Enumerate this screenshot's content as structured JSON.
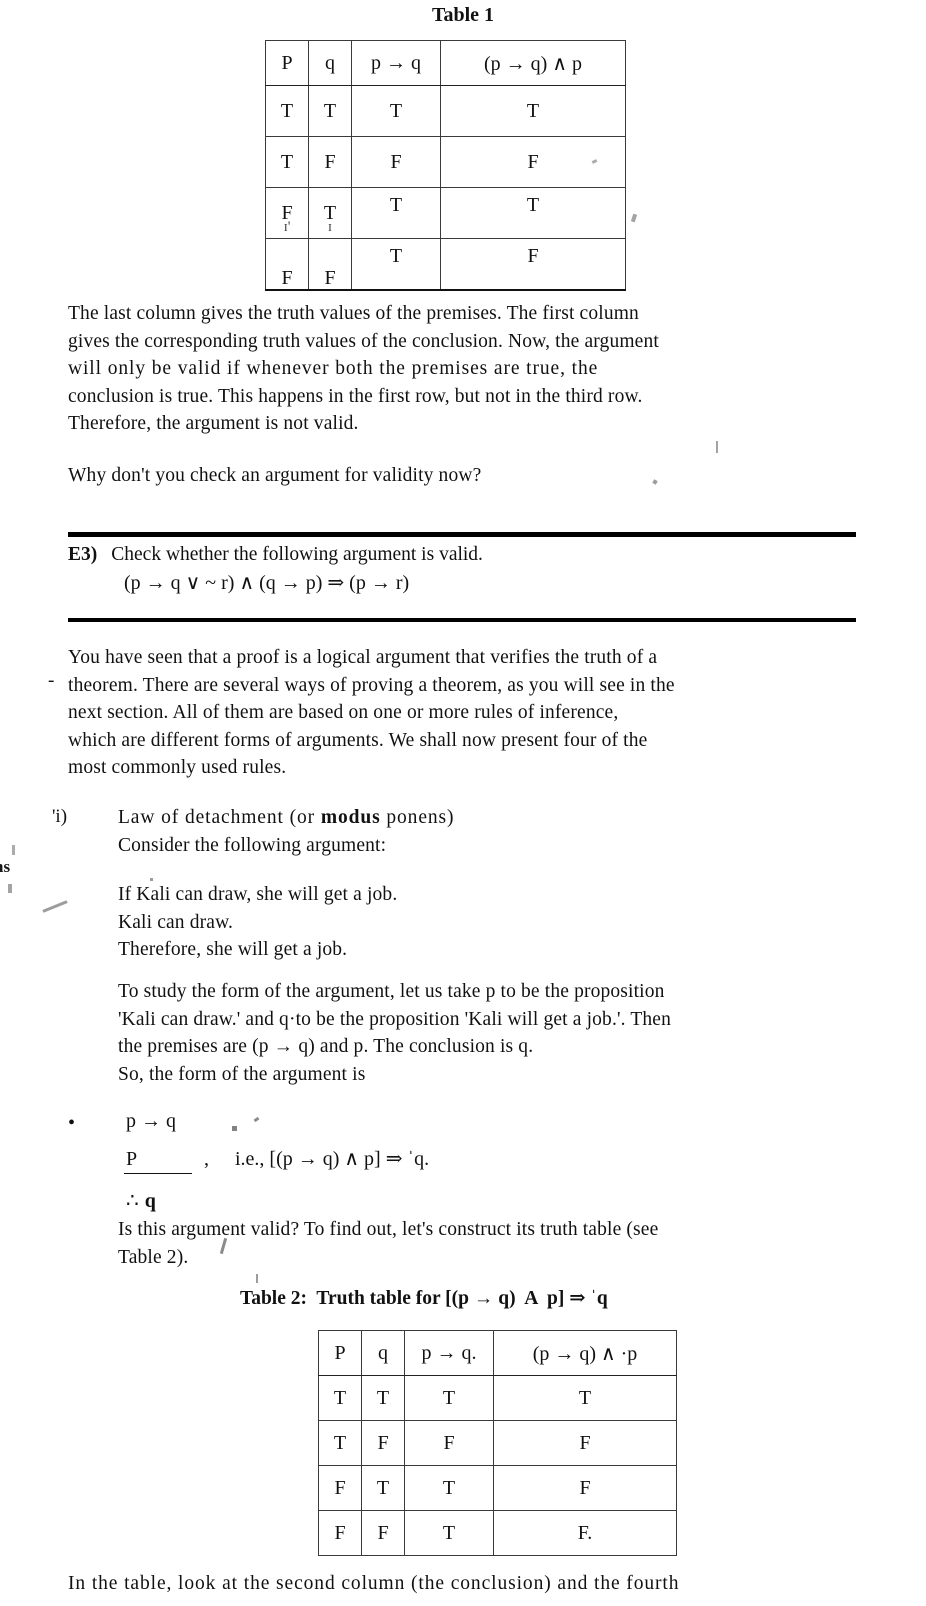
{
  "document": {
    "kind": "scanned-textbook-page",
    "topic": "Logical arguments, validity and rules of inference"
  },
  "table1": {
    "caption": "Table 1",
    "headers": [
      "P",
      "q",
      "p → q",
      "(p → q)  ∧  p"
    ],
    "rows": [
      [
        "T",
        "T",
        "T",
        "T"
      ],
      [
        "T",
        "F",
        "F",
        "F"
      ],
      [
        "F",
        "T",
        "T",
        "T"
      ],
      [
        "F",
        "F",
        "T",
        "F"
      ]
    ]
  },
  "paragraph1": {
    "lines": [
      "The last column gives the truth values of the premises. The first column",
      "gives the corresponding truth values of the conclusion. Now, the argument",
      "will only be valid if whenever both the premises are true, the",
      "conclusion is true. This happens in the first row, but not in the third row.",
      "Therefore, the argument is not valid."
    ]
  },
  "paragraph2": {
    "text": "Why don't you check an argument for validity now?"
  },
  "exercise": {
    "label": "E3)",
    "prompt": "Check whether the following argument is valid.",
    "formula": "(p → q ∨ ~ r) ∧ (q → p) ⇒ (p → r)"
  },
  "paragraph3": {
    "marginal_dash": "-",
    "lines": [
      "You have seen that a proof is a logical argument that verifies the truth of a",
      "theorem. There are several ways of proving a theorem, as you will see in the",
      "next section. All of them are based on one or more rules of inference,",
      "which are different forms of arguments. We shall now present four of the",
      "most commonly used rules."
    ]
  },
  "rule_i": {
    "number": "'i)",
    "title_plain_1": "Law of detachment (or ",
    "title_bold": "modus",
    "title_plain_2": " ponens)",
    "subtitle": "Consider the following argument:",
    "premises": [
      "If Kali can draw, she will get a job.",
      "Kali can draw.",
      "Therefore, she will get a job."
    ]
  },
  "paragraph4": {
    "lines": [
      "To study the form of the argument, let us take p to be the proposition",
      "'Kali can draw.' and q·to be the proposition 'Kali will get a job.'. Then",
      "the premises are (p → q) and p. The conclusion is q.",
      "So, the form of the argument is"
    ]
  },
  "argument_form": {
    "premise1": "p → q",
    "premise2": "P",
    "comma": ",",
    "ie_text": "i.e., [(p → q) ∧ p] ⇒ ˈq.",
    "conclusion_symbol": "∴",
    "conclusion": "q"
  },
  "paragraph5": {
    "lines": [
      "Is this argument valid? To find out, let's construct its truth table (see",
      "Table 2)."
    ]
  },
  "table2": {
    "caption_prefix": "Table 2:",
    "caption_rest": "  Truth table for [(p → q)  A  p] ⇒ ˈq",
    "headers": [
      "P",
      "q",
      "p → q.",
      "(p → q)  ∧  ·p"
    ],
    "rows": [
      [
        "T",
        "T",
        "T",
        "T"
      ],
      [
        "T",
        "F",
        "F",
        "F"
      ],
      [
        "F",
        "T",
        "T",
        "F"
      ],
      [
        "F",
        "F",
        "T",
        "F."
      ]
    ]
  },
  "footer": {
    "text": "In the table, look at the second column (the conclusion) and the fourth"
  },
  "margin_scraps": {
    "fragment": "ns"
  }
}
